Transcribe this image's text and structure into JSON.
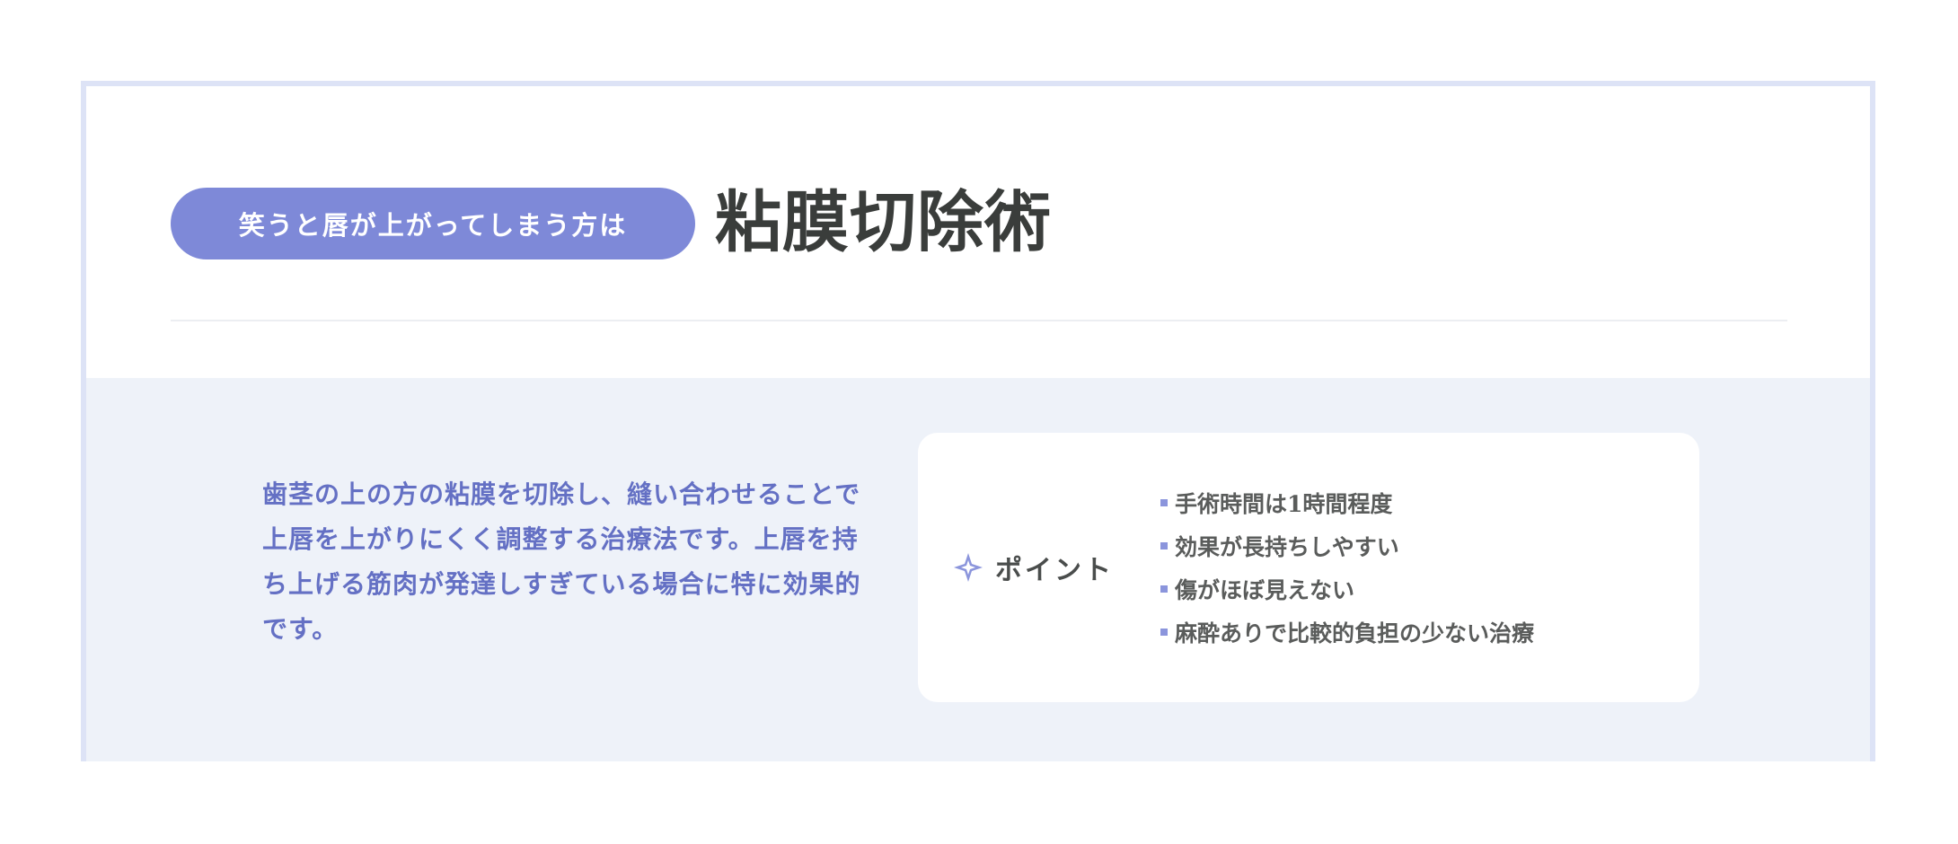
{
  "header": {
    "tag_label": "笑うと唇が上がってしまう方は",
    "title": "粘膜切除術"
  },
  "description": "歯茎の上の方の粘膜を切除し、縫い合わせることで上唇を上がりにくく調整する治療法です。上唇を持ち上げる筋肉が発達しすぎている場合に特に効果的です。",
  "point_card": {
    "icon": "sparkle-icon",
    "label": "ポイント",
    "items": [
      "手術時間は1時間程度",
      "効果が長持ちしやすい",
      "傷がほぼ見えない",
      "麻酔ありで比較的負担の少ない治療"
    ]
  },
  "colors": {
    "accent": "#7e89d8",
    "accent_text": "#6470c4",
    "band_background": "#eef2f9",
    "frame_border": "#dde3f6"
  }
}
